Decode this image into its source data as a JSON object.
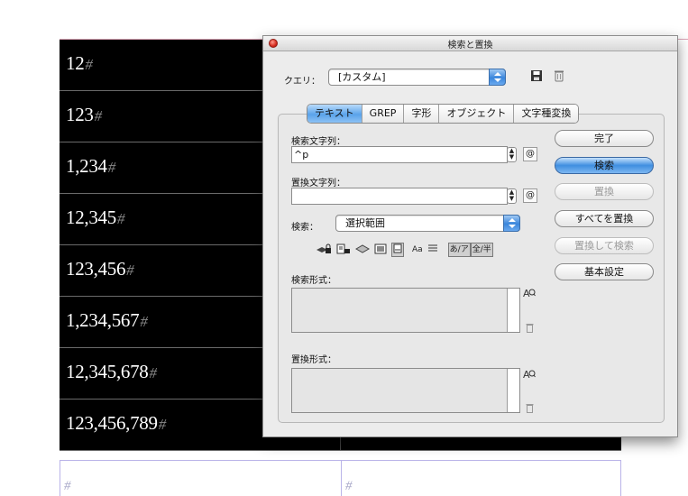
{
  "document": {
    "rows": [
      "12",
      "123",
      "1,234",
      "12,345",
      "123,456",
      "1,234,567",
      "12,345,678",
      "123,456,789"
    ],
    "hash_mark": "#"
  },
  "dialog": {
    "title": "検索と置換",
    "query_label": "クエリ：",
    "query_value": "[カスタム]",
    "tabs": [
      "テキスト",
      "GREP",
      "字形",
      "オブジェクト",
      "文字種変換"
    ],
    "active_tab": "テキスト",
    "find_label": "検索文字列：",
    "find_value": "^p",
    "replace_label": "置換文字列：",
    "replace_value": "",
    "search_label": "検索：",
    "search_value": "選択範囲",
    "options": [
      "Aa",
      "あ/ア",
      "全/半"
    ],
    "find_format_label": "検索形式：",
    "replace_format_label": "置換形式：",
    "buttons": {
      "done": "完了",
      "find": "検索",
      "replace": "置換",
      "replace_all": "すべてを置換",
      "replace_find": "置換して検索",
      "basic": "基本設定"
    },
    "at_symbol": "@"
  }
}
